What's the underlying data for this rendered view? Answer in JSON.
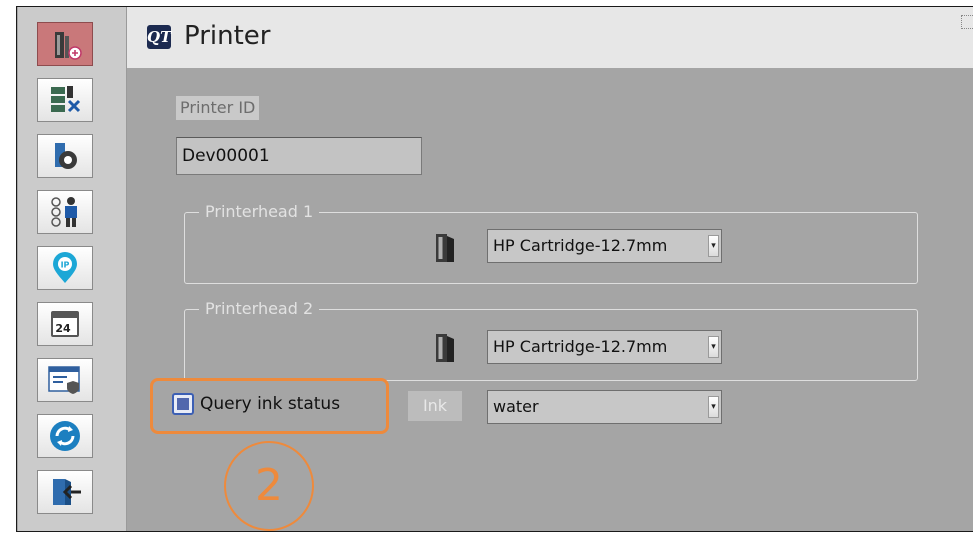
{
  "window": {
    "title": "Printer",
    "logo": "QT"
  },
  "sidebar": {
    "items": [
      {
        "icon": "printer-add-icon",
        "active": true
      },
      {
        "icon": "network-tools-icon",
        "active": false
      },
      {
        "icon": "settings-gear-icon",
        "active": false
      },
      {
        "icon": "user-management-icon",
        "active": false
      },
      {
        "icon": "ip-location-icon",
        "active": false
      },
      {
        "icon": "calendar-24-icon",
        "active": false
      },
      {
        "icon": "security-settings-icon",
        "active": false
      },
      {
        "icon": "sync-icon",
        "active": false
      },
      {
        "icon": "exit-door-icon",
        "active": false
      }
    ]
  },
  "form": {
    "printer_id_label": "Printer ID",
    "printer_id_value": "Dev00001",
    "printerhead1": {
      "title": "Printerhead 1",
      "cartridge": "HP Cartridge-12.7mm"
    },
    "printerhead2": {
      "title": "Printerhead 2",
      "cartridge": "HP Cartridge-12.7mm"
    },
    "query_ink_label": "Query ink status",
    "query_ink_checked": true,
    "ink_label": "Ink",
    "ink_value": "water"
  },
  "annotation": {
    "step_number": "2",
    "color": "#ee8a3c"
  },
  "colors": {
    "active_sidebar": "#c9787a",
    "checkbox_accent": "#3c5fb4",
    "annotation": "#ee8a3c"
  }
}
